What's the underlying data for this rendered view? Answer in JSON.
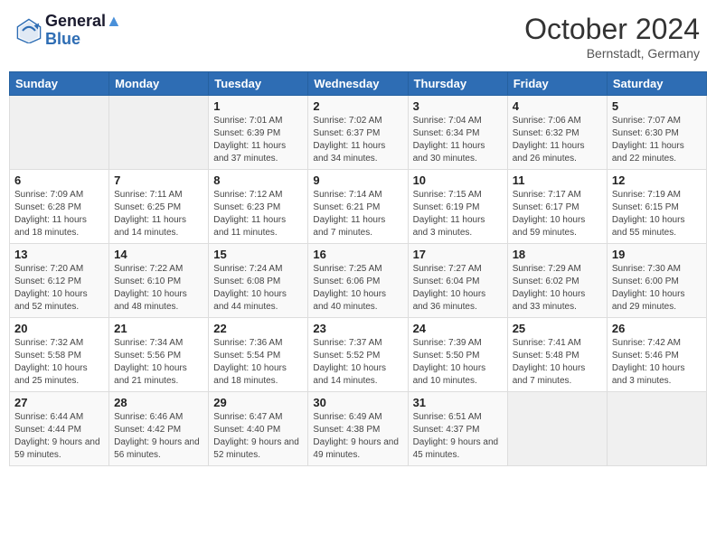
{
  "header": {
    "logo_line1": "General",
    "logo_line2": "Blue",
    "month": "October 2024",
    "location": "Bernstadt, Germany"
  },
  "weekdays": [
    "Sunday",
    "Monday",
    "Tuesday",
    "Wednesday",
    "Thursday",
    "Friday",
    "Saturday"
  ],
  "weeks": [
    [
      {
        "day": "",
        "info": ""
      },
      {
        "day": "",
        "info": ""
      },
      {
        "day": "1",
        "info": "Sunrise: 7:01 AM\nSunset: 6:39 PM\nDaylight: 11 hours and 37 minutes."
      },
      {
        "day": "2",
        "info": "Sunrise: 7:02 AM\nSunset: 6:37 PM\nDaylight: 11 hours and 34 minutes."
      },
      {
        "day": "3",
        "info": "Sunrise: 7:04 AM\nSunset: 6:34 PM\nDaylight: 11 hours and 30 minutes."
      },
      {
        "day": "4",
        "info": "Sunrise: 7:06 AM\nSunset: 6:32 PM\nDaylight: 11 hours and 26 minutes."
      },
      {
        "day": "5",
        "info": "Sunrise: 7:07 AM\nSunset: 6:30 PM\nDaylight: 11 hours and 22 minutes."
      }
    ],
    [
      {
        "day": "6",
        "info": "Sunrise: 7:09 AM\nSunset: 6:28 PM\nDaylight: 11 hours and 18 minutes."
      },
      {
        "day": "7",
        "info": "Sunrise: 7:11 AM\nSunset: 6:25 PM\nDaylight: 11 hours and 14 minutes."
      },
      {
        "day": "8",
        "info": "Sunrise: 7:12 AM\nSunset: 6:23 PM\nDaylight: 11 hours and 11 minutes."
      },
      {
        "day": "9",
        "info": "Sunrise: 7:14 AM\nSunset: 6:21 PM\nDaylight: 11 hours and 7 minutes."
      },
      {
        "day": "10",
        "info": "Sunrise: 7:15 AM\nSunset: 6:19 PM\nDaylight: 11 hours and 3 minutes."
      },
      {
        "day": "11",
        "info": "Sunrise: 7:17 AM\nSunset: 6:17 PM\nDaylight: 10 hours and 59 minutes."
      },
      {
        "day": "12",
        "info": "Sunrise: 7:19 AM\nSunset: 6:15 PM\nDaylight: 10 hours and 55 minutes."
      }
    ],
    [
      {
        "day": "13",
        "info": "Sunrise: 7:20 AM\nSunset: 6:12 PM\nDaylight: 10 hours and 52 minutes."
      },
      {
        "day": "14",
        "info": "Sunrise: 7:22 AM\nSunset: 6:10 PM\nDaylight: 10 hours and 48 minutes."
      },
      {
        "day": "15",
        "info": "Sunrise: 7:24 AM\nSunset: 6:08 PM\nDaylight: 10 hours and 44 minutes."
      },
      {
        "day": "16",
        "info": "Sunrise: 7:25 AM\nSunset: 6:06 PM\nDaylight: 10 hours and 40 minutes."
      },
      {
        "day": "17",
        "info": "Sunrise: 7:27 AM\nSunset: 6:04 PM\nDaylight: 10 hours and 36 minutes."
      },
      {
        "day": "18",
        "info": "Sunrise: 7:29 AM\nSunset: 6:02 PM\nDaylight: 10 hours and 33 minutes."
      },
      {
        "day": "19",
        "info": "Sunrise: 7:30 AM\nSunset: 6:00 PM\nDaylight: 10 hours and 29 minutes."
      }
    ],
    [
      {
        "day": "20",
        "info": "Sunrise: 7:32 AM\nSunset: 5:58 PM\nDaylight: 10 hours and 25 minutes."
      },
      {
        "day": "21",
        "info": "Sunrise: 7:34 AM\nSunset: 5:56 PM\nDaylight: 10 hours and 21 minutes."
      },
      {
        "day": "22",
        "info": "Sunrise: 7:36 AM\nSunset: 5:54 PM\nDaylight: 10 hours and 18 minutes."
      },
      {
        "day": "23",
        "info": "Sunrise: 7:37 AM\nSunset: 5:52 PM\nDaylight: 10 hours and 14 minutes."
      },
      {
        "day": "24",
        "info": "Sunrise: 7:39 AM\nSunset: 5:50 PM\nDaylight: 10 hours and 10 minutes."
      },
      {
        "day": "25",
        "info": "Sunrise: 7:41 AM\nSunset: 5:48 PM\nDaylight: 10 hours and 7 minutes."
      },
      {
        "day": "26",
        "info": "Sunrise: 7:42 AM\nSunset: 5:46 PM\nDaylight: 10 hours and 3 minutes."
      }
    ],
    [
      {
        "day": "27",
        "info": "Sunrise: 6:44 AM\nSunset: 4:44 PM\nDaylight: 9 hours and 59 minutes."
      },
      {
        "day": "28",
        "info": "Sunrise: 6:46 AM\nSunset: 4:42 PM\nDaylight: 9 hours and 56 minutes."
      },
      {
        "day": "29",
        "info": "Sunrise: 6:47 AM\nSunset: 4:40 PM\nDaylight: 9 hours and 52 minutes."
      },
      {
        "day": "30",
        "info": "Sunrise: 6:49 AM\nSunset: 4:38 PM\nDaylight: 9 hours and 49 minutes."
      },
      {
        "day": "31",
        "info": "Sunrise: 6:51 AM\nSunset: 4:37 PM\nDaylight: 9 hours and 45 minutes."
      },
      {
        "day": "",
        "info": ""
      },
      {
        "day": "",
        "info": ""
      }
    ]
  ]
}
